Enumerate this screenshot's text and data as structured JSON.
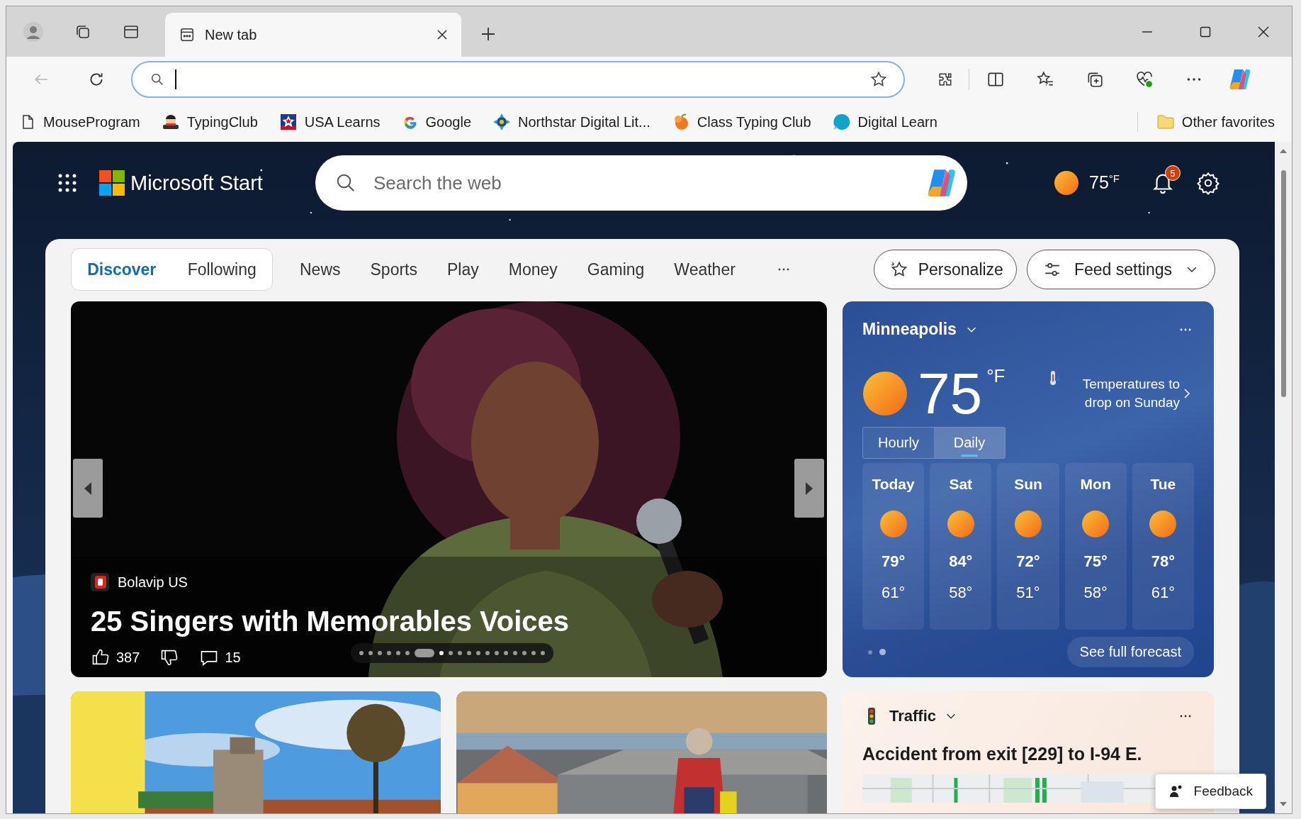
{
  "browser": {
    "tabs": [
      {
        "title": "New tab",
        "selected": true
      }
    ],
    "back_disabled": true,
    "address_focused": true,
    "favorites": [
      {
        "label": "MouseProgram"
      },
      {
        "label": "TypingClub"
      },
      {
        "label": "USA Learns"
      },
      {
        "label": "Google"
      },
      {
        "label": "Northstar Digital Lit..."
      },
      {
        "label": "Class Typing Club"
      },
      {
        "label": "Digital Learn"
      }
    ],
    "other_favorites": "Other favorites"
  },
  "page": {
    "brand": "Microsoft Start",
    "search_placeholder": "Search the web",
    "header_weather": "75$^{°F}$",
    "notification_count": "5",
    "feed_tabs": [
      {
        "label": "Discover",
        "selected": true
      },
      {
        "label": "Following",
        "selected": false
      }
    ],
    "categories": [
      "News",
      "Sports",
      "Play",
      "Money",
      "Gaming",
      "Weather"
    ],
    "personalize": "Personalize",
    "feed_settings": "Feed settings",
    "hero": {
      "source": "Bolavip US",
      "headline": "25 Singers with Memorables Voices",
      "likes": "387",
      "comments": "15",
      "dots": [
        {
          "kind": "dot",
          "selected": false
        },
        {
          "kind": "dot",
          "selected": false
        },
        {
          "kind": "dot",
          "selected": false
        },
        {
          "kind": "dot",
          "selected": false
        },
        {
          "kind": "dot",
          "selected": false
        },
        {
          "kind": "dot",
          "selected": false
        },
        {
          "kind": "pill",
          "selected": false
        },
        {
          "kind": "dot",
          "selected": true
        },
        {
          "kind": "dot",
          "selected": false
        },
        {
          "kind": "dot",
          "selected": false
        },
        {
          "kind": "dot",
          "selected": false
        },
        {
          "kind": "dot",
          "selected": false
        },
        {
          "kind": "dot",
          "selected": false
        },
        {
          "kind": "dot",
          "selected": false
        },
        {
          "kind": "dot",
          "selected": false
        },
        {
          "kind": "dot",
          "selected": false
        },
        {
          "kind": "dot",
          "selected": false
        },
        {
          "kind": "dot",
          "selected": false
        },
        {
          "kind": "dot",
          "selected": false
        }
      ]
    },
    "weather": {
      "city": "Minneapolis",
      "temp": "75",
      "unit": "°F",
      "alert": "Temperatures to drop on Sunday",
      "views": [
        {
          "label": "Hourly",
          "selected": false
        },
        {
          "label": "Daily",
          "selected": true
        }
      ],
      "days": [
        {
          "day": "Today",
          "high": "79°",
          "low": "61°"
        },
        {
          "day": "Sat",
          "high": "84°",
          "low": "58°"
        },
        {
          "day": "Sun",
          "high": "72°",
          "low": "51°"
        },
        {
          "day": "Mon",
          "high": "75°",
          "low": "58°"
        },
        {
          "day": "Tue",
          "high": "78°",
          "low": "61°"
        }
      ],
      "pages": [
        {
          "selected": false
        },
        {
          "selected": true
        }
      ],
      "forecast_link": "See full forecast"
    },
    "news_cards": [
      {
        "kind": "picture"
      },
      {
        "kind": "picture"
      }
    ],
    "traffic": {
      "title": "Traffic",
      "headline": "Accident from exit [229] to I-94 E."
    },
    "feedback": "Feedback"
  }
}
